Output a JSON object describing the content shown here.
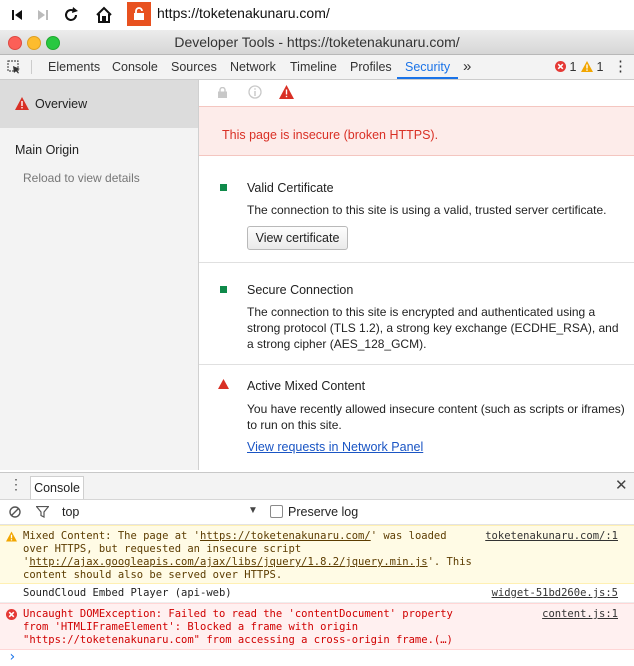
{
  "browser": {
    "url": "https://toketenakunaru.com/"
  },
  "window": {
    "title": "Developer Tools - https://toketenakunaru.com/"
  },
  "tabs": [
    {
      "label": "Elements"
    },
    {
      "label": "Console"
    },
    {
      "label": "Sources"
    },
    {
      "label": "Network"
    },
    {
      "label": "Timeline"
    },
    {
      "label": "Profiles"
    },
    {
      "label": "Security",
      "active": true
    }
  ],
  "tab_overflow": "»",
  "counts": {
    "errors": "1",
    "warnings": "1"
  },
  "sidebar": {
    "overview": "Overview",
    "main_origin": "Main Origin",
    "reload_hint": "Reload to view details"
  },
  "banner": "This page is insecure (broken HTTPS).",
  "sections": {
    "certificate": {
      "title": "Valid Certificate",
      "desc": "The connection to this site is using a valid, trusted server certificate.",
      "button": "View certificate"
    },
    "connection": {
      "title": "Secure Connection",
      "desc": "The connection to this site is encrypted and authenticated using a strong protocol (TLS 1.2), a strong key exchange (ECDHE_RSA), and a strong cipher (AES_128_GCM)."
    },
    "mixed": {
      "title": "Active Mixed Content",
      "desc": "You have recently allowed insecure content (such as scripts or iframes) to run on this site.",
      "link": "View requests in Network Panel"
    }
  },
  "drawer": {
    "tab": "Console",
    "context": "top",
    "preserve_log": "Preserve log"
  },
  "console": {
    "warning": {
      "pre": "Mixed Content: The page at '",
      "url1": "https://toketenakunaru.com/",
      "mid": "' was loaded over HTTPS, but requested an insecure script '",
      "url2": "http://ajax.googleapis.com/ajax/libs/jquery/1.8.2/jquery.min.js",
      "post": "'. This content should also be served over HTTPS.",
      "source": "toketenakunaru.com/:1"
    },
    "log": {
      "text": "SoundCloud Embed Player (api-web)",
      "source": "widget-51bd260e.js:5"
    },
    "error": {
      "text": "Uncaught DOMException: Failed to read the 'contentDocument' property from 'HTMLIFrameElement': Blocked a frame with origin \"https://toketenakunaru.com\" from accessing a cross-origin frame.(…)",
      "source": "content.js:1"
    },
    "prompt": "›"
  },
  "colors": {
    "accent": "#1a73e8",
    "insecure": "#d93025",
    "secure": "#0f8a4a",
    "lock_badge": "#e8511f"
  }
}
